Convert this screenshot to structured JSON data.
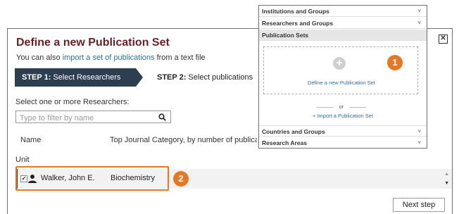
{
  "dialog": {
    "title": "Define a new Publication Set",
    "subtitle_prefix": "You can also ",
    "subtitle_link": "import a set of publications",
    "subtitle_suffix": " from a text file",
    "close_glyph": "✕"
  },
  "steps": {
    "step1_label": "STEP 1:",
    "step1_text": " Select Researchers",
    "step2_label": "STEP 2:",
    "step2_text": " Select publications"
  },
  "filter": {
    "label": "Select one or more Researchers:",
    "placeholder": "Type to filter by name",
    "icon": "search-icon"
  },
  "table": {
    "columns": [
      "Name",
      "Top Journal Category, by number of publications",
      "Unit"
    ],
    "rows": [
      {
        "name": "Walker, John E.",
        "category": "Biochemistry",
        "checked": true
      }
    ]
  },
  "next_button": "Next step",
  "annotations": {
    "badge1": "1",
    "badge2": "2",
    "color": "#e87722"
  },
  "panel": {
    "items": [
      {
        "label": "Institutions and Groups",
        "chevron": "˅"
      },
      {
        "label": "Researchers and Groups",
        "chevron": "˅"
      },
      {
        "label": "Publication Sets"
      }
    ],
    "define_label": "Define a new Publication Set",
    "or_text": "or",
    "import_label": "+ Import a Publication Set",
    "bottom_items": [
      {
        "label": "Countries and Groups",
        "chevron": "˅"
      },
      {
        "label": "Research Areas",
        "chevron": "˅"
      }
    ]
  },
  "colors": {
    "title": "#6b1f24",
    "step_active": "#2c3e50",
    "link": "#2a6fa8"
  }
}
